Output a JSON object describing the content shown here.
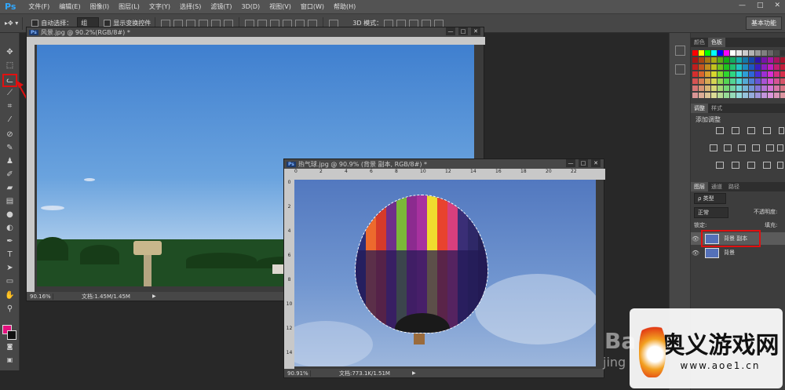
{
  "app": {
    "logo": "Ps",
    "menus": [
      "文件(F)",
      "编辑(E)",
      "图像(I)",
      "图层(L)",
      "文字(Y)",
      "选择(S)",
      "滤镜(T)",
      "3D(D)",
      "视图(V)",
      "窗口(W)",
      "帮助(H)"
    ],
    "window_controls": [
      "—",
      "□",
      "✕"
    ]
  },
  "options": {
    "auto_select_label": "自动选择：",
    "auto_select_value": "组",
    "show_transform_label": "显示变换控件",
    "mode_3d_label": "3D 模式：",
    "workspace": "基本功能"
  },
  "docs": [
    {
      "title": "风景.jpg @ 90.2%(RGB/8#) *",
      "zoom": "90.16%",
      "info": "文档:1.45M/1.45M"
    },
    {
      "title": "热气球.jpg @ 90.9% (背景 副本, RGB/8#) *",
      "zoom": "90.91%",
      "info": "文档:773.1K/1.51M",
      "ruler_top": [
        "0",
        "2",
        "4",
        "6",
        "8",
        "10",
        "12",
        "14",
        "16",
        "18",
        "20",
        "22"
      ],
      "ruler_left": [
        "0",
        "2",
        "4",
        "6",
        "8",
        "10",
        "12",
        "14"
      ]
    }
  ],
  "panels": {
    "tab_color": "颜色",
    "tab_swatches": "色板",
    "tab_adjust": "调整",
    "tab_styles": "样式",
    "adjust_title": "添加调整",
    "tab_layers": "图层",
    "tab_channels": "通道",
    "tab_paths": "路径",
    "kind_label": "ρ 类型",
    "blend_mode": "正常",
    "opacity_label": "不透明度:",
    "lock_label": "锁定:",
    "fill_label": "填充:",
    "layers": [
      "背景 副本",
      "背景"
    ]
  },
  "watermark": {
    "title": "奥义游戏网",
    "url": "www.aoe1.cn",
    "baidu": "Ba",
    "baidu2": "jing"
  },
  "colors": {
    "foreground": "#e4107e",
    "background": "#111111",
    "highlight": "#e01010"
  }
}
